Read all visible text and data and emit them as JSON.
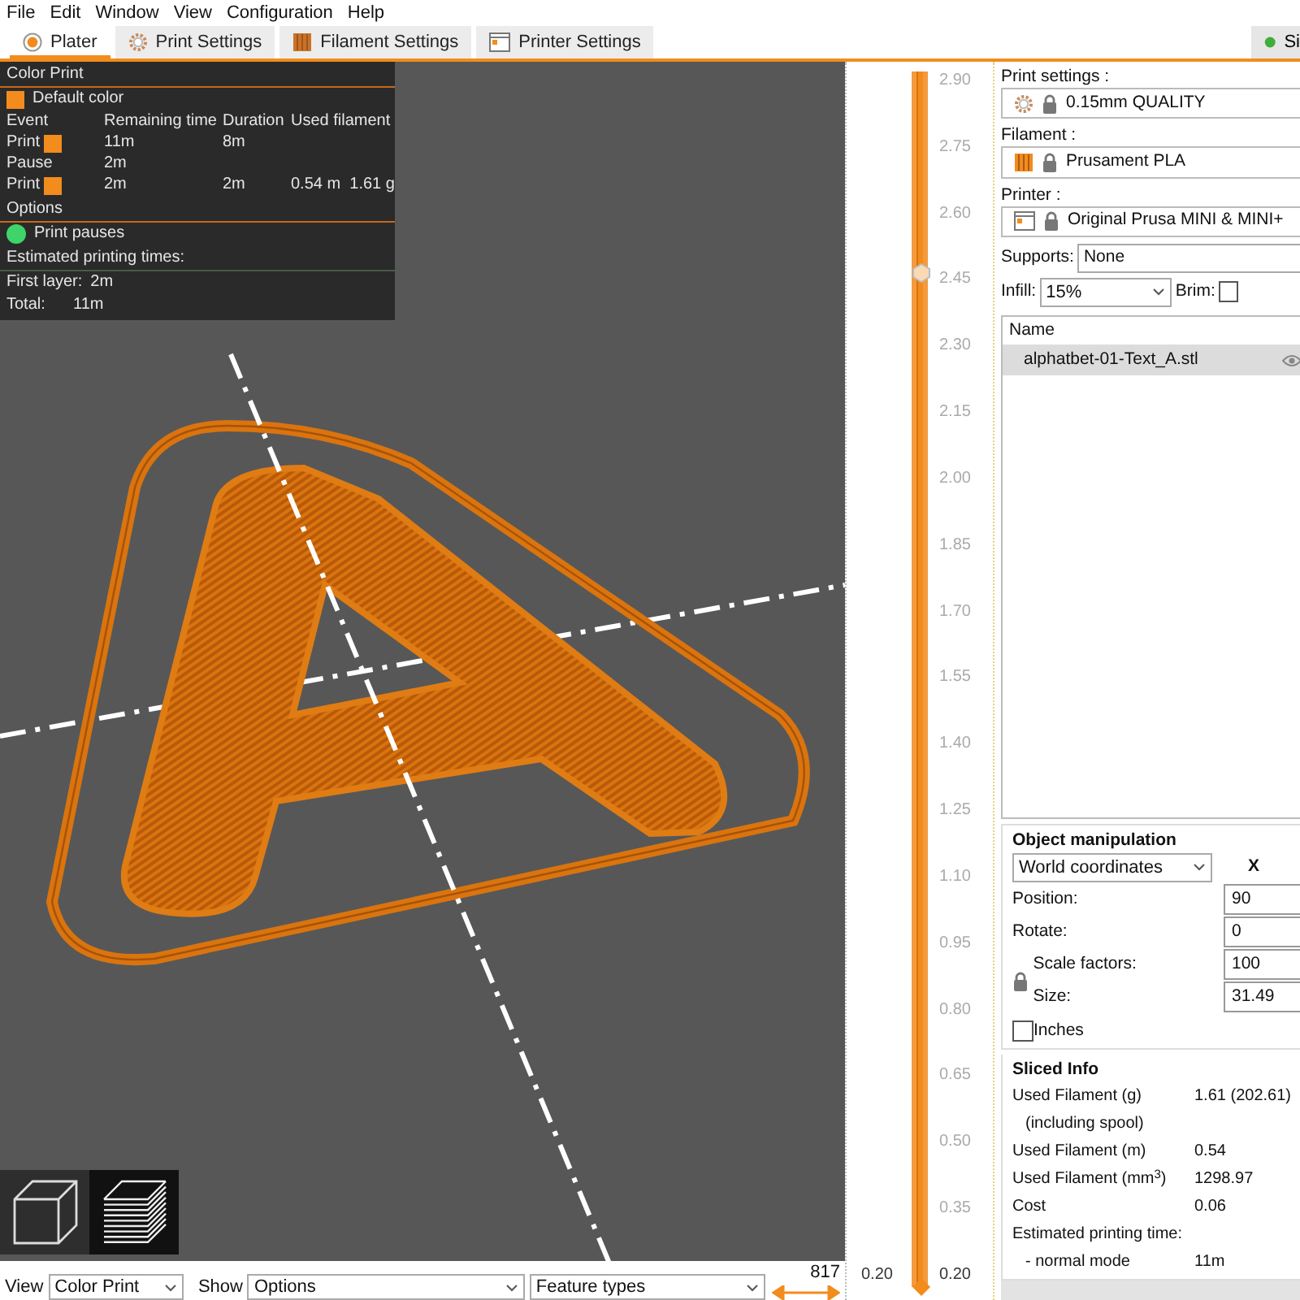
{
  "menu": [
    "File",
    "Edit",
    "Window",
    "View",
    "Configuration",
    "Help"
  ],
  "tabs": [
    {
      "label": "Plater",
      "kind": "plater",
      "selected": true
    },
    {
      "label": "Print Settings",
      "kind": "print",
      "selected": false
    },
    {
      "label": "Filament Settings",
      "kind": "filament",
      "selected": false
    },
    {
      "label": "Printer Settings",
      "kind": "printer",
      "selected": false
    }
  ],
  "preview_button": {
    "label": "Si"
  },
  "legend": {
    "title": "Color Print",
    "default_color": {
      "label": "Default color",
      "color": "#f28c1c"
    },
    "columns": [
      "Event",
      "Remaining time",
      "Duration",
      "Used filament"
    ],
    "rows": [
      {
        "event": "Print",
        "color": "#f28c1c",
        "remaining": "11m",
        "duration": "8m"
      },
      {
        "event": "Pause",
        "remaining": "2m"
      },
      {
        "event": "Print",
        "color": "#f28c1c",
        "remaining": "2m",
        "duration": "2m",
        "used_filament": "0.54 m  1.61 g"
      }
    ],
    "options_title": "Options",
    "options": [
      {
        "label": "Print pauses",
        "color": "#3ed46a"
      }
    ],
    "times_title": "Estimated printing times:",
    "times": [
      {
        "label": "First layer:",
        "value": "2m"
      },
      {
        "label": "Total:",
        "value": "11m"
      }
    ]
  },
  "view_modes": [
    {
      "kind": "cube",
      "selected": false
    },
    {
      "kind": "layers",
      "selected": true
    }
  ],
  "bottom_bar": {
    "view_label": "View",
    "view": "Color Print",
    "show_label": "Show",
    "show": "Options",
    "feature": "Feature types",
    "width_value": "817"
  },
  "layer_slider": {
    "ticks": [
      "2.90",
      "2.75",
      "2.60",
      "2.45",
      "2.30",
      "2.15",
      "2.00",
      "1.85",
      "1.70",
      "1.55",
      "1.40",
      "1.25",
      "1.10",
      "0.95",
      "0.80",
      "0.65",
      "0.50",
      "0.35",
      "0.20"
    ],
    "lower_value": "0.20"
  },
  "presets": [
    {
      "label": "Print settings :",
      "value": "0.15mm QUALITY",
      "kind": "print"
    },
    {
      "label": "Filament :",
      "value": "Prusament PLA",
      "kind": "filament",
      "color": "#f28c1c"
    },
    {
      "label": "Printer :",
      "value": "Original Prusa MINI & MINI+",
      "kind": "printer"
    }
  ],
  "supports": {
    "label": "Supports:",
    "value": "None"
  },
  "infill": {
    "label": "Infill:",
    "value": "15%"
  },
  "brim": {
    "label": "Brim:",
    "checked": false
  },
  "object_list": {
    "column": "Name",
    "rows": [
      {
        "name": "alphatbet-01-Text_A.stl",
        "selected": true
      }
    ]
  },
  "object_manipulation": {
    "title": "Object manipulation",
    "coordinates": "World coordinates",
    "axis": "X",
    "fields": [
      {
        "label": "Position:",
        "value": "90",
        "kind": "plain"
      },
      {
        "label": "Rotate:",
        "value": "0",
        "kind": "plain"
      },
      {
        "label": "Scale factors:",
        "value": "100",
        "kind": "locked"
      },
      {
        "label": "Size:",
        "value": "31.49",
        "kind": "locked"
      }
    ],
    "inches": {
      "label": "Inches",
      "checked": false
    }
  },
  "sliced_info": {
    "title": "Sliced Info",
    "rows": [
      {
        "kind": "main",
        "label": "Used Filament (g)",
        "value": "1.61 (202.61)"
      },
      {
        "kind": "sub",
        "label": "(including spool)"
      },
      {
        "kind": "main",
        "label": "Used Filament (m)",
        "value": "0.54"
      },
      {
        "kind": "main",
        "label": "Used Filament (mm$^{3}$)",
        "value": "1298.97"
      },
      {
        "kind": "main",
        "label": "Cost",
        "value": "0.06"
      },
      {
        "kind": "main",
        "label": "Estimated printing time:"
      },
      {
        "kind": "sub",
        "label": "- normal mode",
        "value": "11m"
      }
    ]
  }
}
